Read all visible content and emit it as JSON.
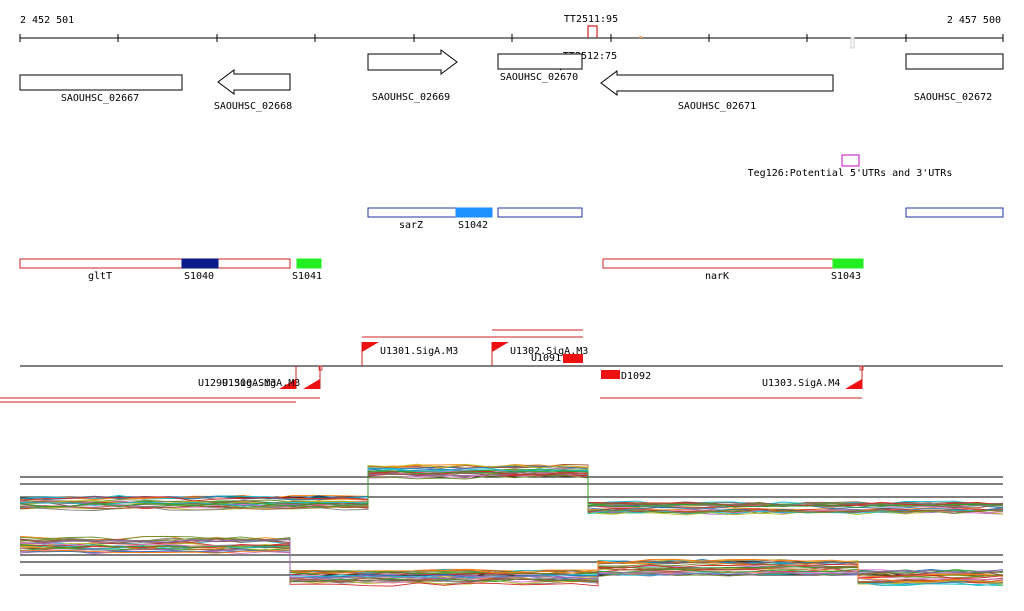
{
  "axis": {
    "start_label": "2 452 501",
    "end_label": "2 457 500"
  },
  "terminators": [
    {
      "label": "TT2511:95"
    },
    {
      "label": "TT2512:75"
    }
  ],
  "genes": [
    {
      "id": "g1",
      "label": "SAOUHSC_02667",
      "strand": "+"
    },
    {
      "id": "g2",
      "label": "SAOUHSC_02668",
      "strand": "-"
    },
    {
      "id": "g3",
      "label": "SAOUHSC_02669",
      "strand": "+"
    },
    {
      "id": "g4",
      "label": "SAOUHSC_02670",
      "strand": "+"
    },
    {
      "id": "g5",
      "label": "SAOUHSC_02671",
      "strand": "-"
    },
    {
      "id": "g6",
      "label": "SAOUHSC_02672",
      "strand": "+"
    }
  ],
  "utr_feature": {
    "label": "Teg126:Potential 5'UTRs and 3'UTRs",
    "color": "#cc33cc"
  },
  "blue_track": {
    "color": "#2233aa",
    "items": [
      {
        "id": "sarZ",
        "label": "sarZ"
      },
      {
        "id": "s1042",
        "label": "S1042",
        "color": "#1e90ff"
      }
    ]
  },
  "red_track": {
    "color": "#cc2222",
    "items": [
      {
        "id": "gltT",
        "label": "gltT"
      },
      {
        "id": "s1040",
        "label": "S1040",
        "color": "#0b1a88"
      },
      {
        "id": "s1041",
        "label": "S1041",
        "color": "#22ee22"
      },
      {
        "id": "narK",
        "label": "narK"
      },
      {
        "id": "s1043",
        "label": "S1043",
        "color": "#22ee22"
      }
    ]
  },
  "promoters": [
    {
      "id": "u1301",
      "label": "U1301.SigA.M3"
    },
    {
      "id": "u1302",
      "label": "U1302.SigA.M3"
    },
    {
      "id": "u1091",
      "label": "U1091"
    },
    {
      "id": "d1092",
      "label": "D1092"
    },
    {
      "id": "u1299",
      "label": "U1299.SigA.M3"
    },
    {
      "id": "u1300",
      "label": "U1300.SigA.M3"
    },
    {
      "id": "u1303",
      "label": "U1303.SigA.M4"
    }
  ],
  "expression": {
    "palette": [
      "#d62728",
      "#2ca02c",
      "#8c564b",
      "#ff7f0e",
      "#9467bd",
      "#1f77b4",
      "#bcbd22",
      "#e377c2",
      "#7f7f7f",
      "#17becf",
      "#a0522d",
      "#6b8e23"
    ]
  }
}
